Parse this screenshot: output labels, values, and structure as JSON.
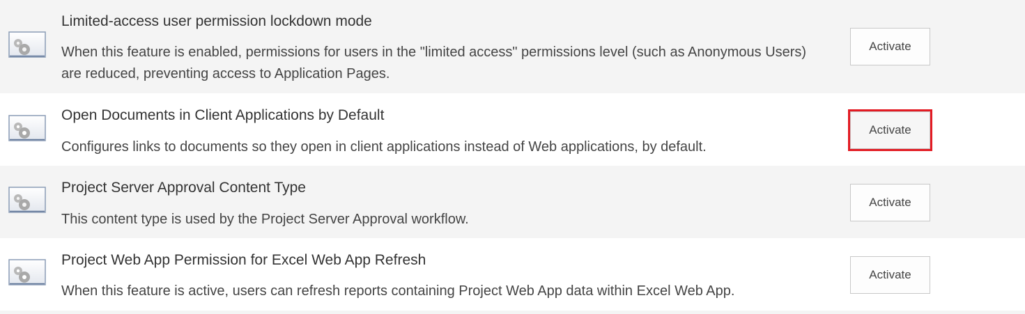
{
  "features": [
    {
      "title": "Limited-access user permission lockdown mode",
      "description": "When this feature is enabled, permissions for users in the \"limited access\" permissions level (such as Anonymous Users) are reduced, preventing access to Application Pages.",
      "button_label": "Activate",
      "icon": "feature-gear-icon"
    },
    {
      "title": "Open Documents in Client Applications by Default",
      "description": "Configures links to documents so they open in client applications instead of Web applications, by default.",
      "button_label": "Activate",
      "icon": "feature-gear-icon",
      "highlighted": true
    },
    {
      "title": "Project Server Approval Content Type",
      "description": "This content type is used by the Project Server Approval workflow.",
      "button_label": "Activate",
      "icon": "feature-gear-icon"
    },
    {
      "title": "Project Web App Permission for Excel Web App Refresh",
      "description": "When this feature is active, users can refresh reports containing Project Web App data within Excel Web App.",
      "button_label": "Activate",
      "icon": "feature-gear-icon"
    }
  ],
  "colors": {
    "highlight_border": "#e31b23",
    "alt_row_background": "#f4f4f4"
  }
}
